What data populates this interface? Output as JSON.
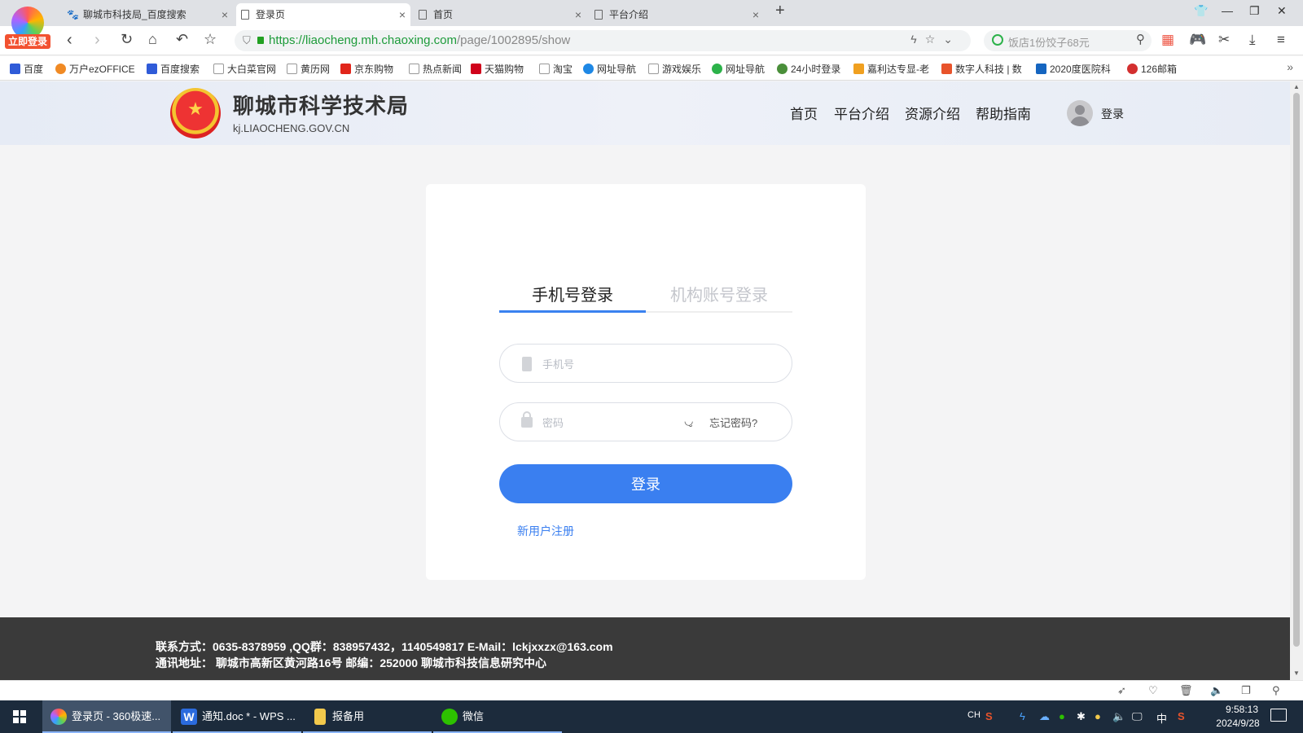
{
  "browser": {
    "badge_label": "立即登录",
    "tabs": [
      {
        "label": "聊城市科技局_百度搜索",
        "active": false,
        "icon": "baidu-paw-icon"
      },
      {
        "label": "登录页",
        "active": true,
        "icon": "page-icon"
      },
      {
        "label": "首页",
        "active": false,
        "icon": "page-icon"
      },
      {
        "label": "平台介绍",
        "active": false,
        "icon": "page-icon"
      }
    ],
    "url_host": "https://liaocheng.mh.chaoxing.com",
    "url_path": "/page/1002895/show",
    "search_placeholder": "饭店1份饺子68元",
    "bookmarks": [
      {
        "label": "百度",
        "icon": "baidu-paw-icon",
        "color": "#2f5bd8"
      },
      {
        "label": "万户ezOFFICE",
        "icon": "ezoffice-icon",
        "color": "#f08a24"
      },
      {
        "label": "百度搜索",
        "icon": "baidu-paw-icon",
        "color": "#2f5bd8"
      },
      {
        "label": "大白菜官网",
        "icon": "page-icon",
        "color": "#999999"
      },
      {
        "label": "黄历网",
        "icon": "page-icon",
        "color": "#999999"
      },
      {
        "label": "京东购物",
        "icon": "jd-icon",
        "color": "#e1251b"
      },
      {
        "label": "热点新闻",
        "icon": "page-icon",
        "color": "#999999"
      },
      {
        "label": "天猫购物",
        "icon": "tmall-icon",
        "color": "#d0021b"
      },
      {
        "label": "淘宝",
        "icon": "page-icon",
        "color": "#999999"
      },
      {
        "label": "网址导航",
        "icon": "nav-icon",
        "color": "#1e88e5"
      },
      {
        "label": "游戏娱乐",
        "icon": "page-icon",
        "color": "#999999"
      },
      {
        "label": "网址导航",
        "icon": "nav-icon",
        "color": "#2cb24a"
      },
      {
        "label": "24小时登录",
        "icon": "globe-icon",
        "color": "#4a8f3a"
      },
      {
        "label": "嘉利达专显-老",
        "icon": "signal-icon",
        "color": "#f0a020"
      },
      {
        "label": "数字人科技 | 数",
        "icon": "dh-icon",
        "color": "#e8532b"
      },
      {
        "label": "2020度医院科",
        "icon": "person-icon",
        "color": "#1565c0"
      },
      {
        "label": "126邮箱",
        "icon": "mail-icon",
        "color": "#d32f2f"
      }
    ]
  },
  "site": {
    "name": "聊城市科学技术局",
    "domain": "kj.LIAOCHENG.GOV.CN",
    "nav": [
      "首页",
      "平台介绍",
      "资源介绍",
      "帮助指南"
    ],
    "login_label": "登录"
  },
  "login": {
    "tabs": [
      "手机号登录",
      "机构账号登录"
    ],
    "active_tab": "手机号登录",
    "phone_placeholder": "手机号",
    "password_placeholder": "密码",
    "forgot_label": "忘记密码?",
    "submit_label": "登录",
    "register_label": "新用户注册",
    "accent_color": "#3a7ff0"
  },
  "footer": {
    "contact": "联系方式：0635-8378959 ,QQ群：838957432，1140549817 E-Mail：lckjxxzx@163.com",
    "address": "通讯地址： 聊城市高新区黄河路16号 邮编：252000 聊城市科技信息研究中心"
  },
  "taskbar": {
    "tasks": [
      {
        "label": "登录页 - 360极速...",
        "icon": "360-browser-icon",
        "state": "active"
      },
      {
        "label": "通知.doc * - WPS ...",
        "icon": "wps-writer-icon",
        "state": "open"
      },
      {
        "label": "报备用",
        "icon": "folder-icon",
        "state": "open"
      },
      {
        "label": "微信",
        "icon": "wechat-icon",
        "state": "open"
      }
    ],
    "ime_label": "中",
    "lang_label": "CH",
    "time": "9:58:13",
    "date": "2024/9/28"
  }
}
